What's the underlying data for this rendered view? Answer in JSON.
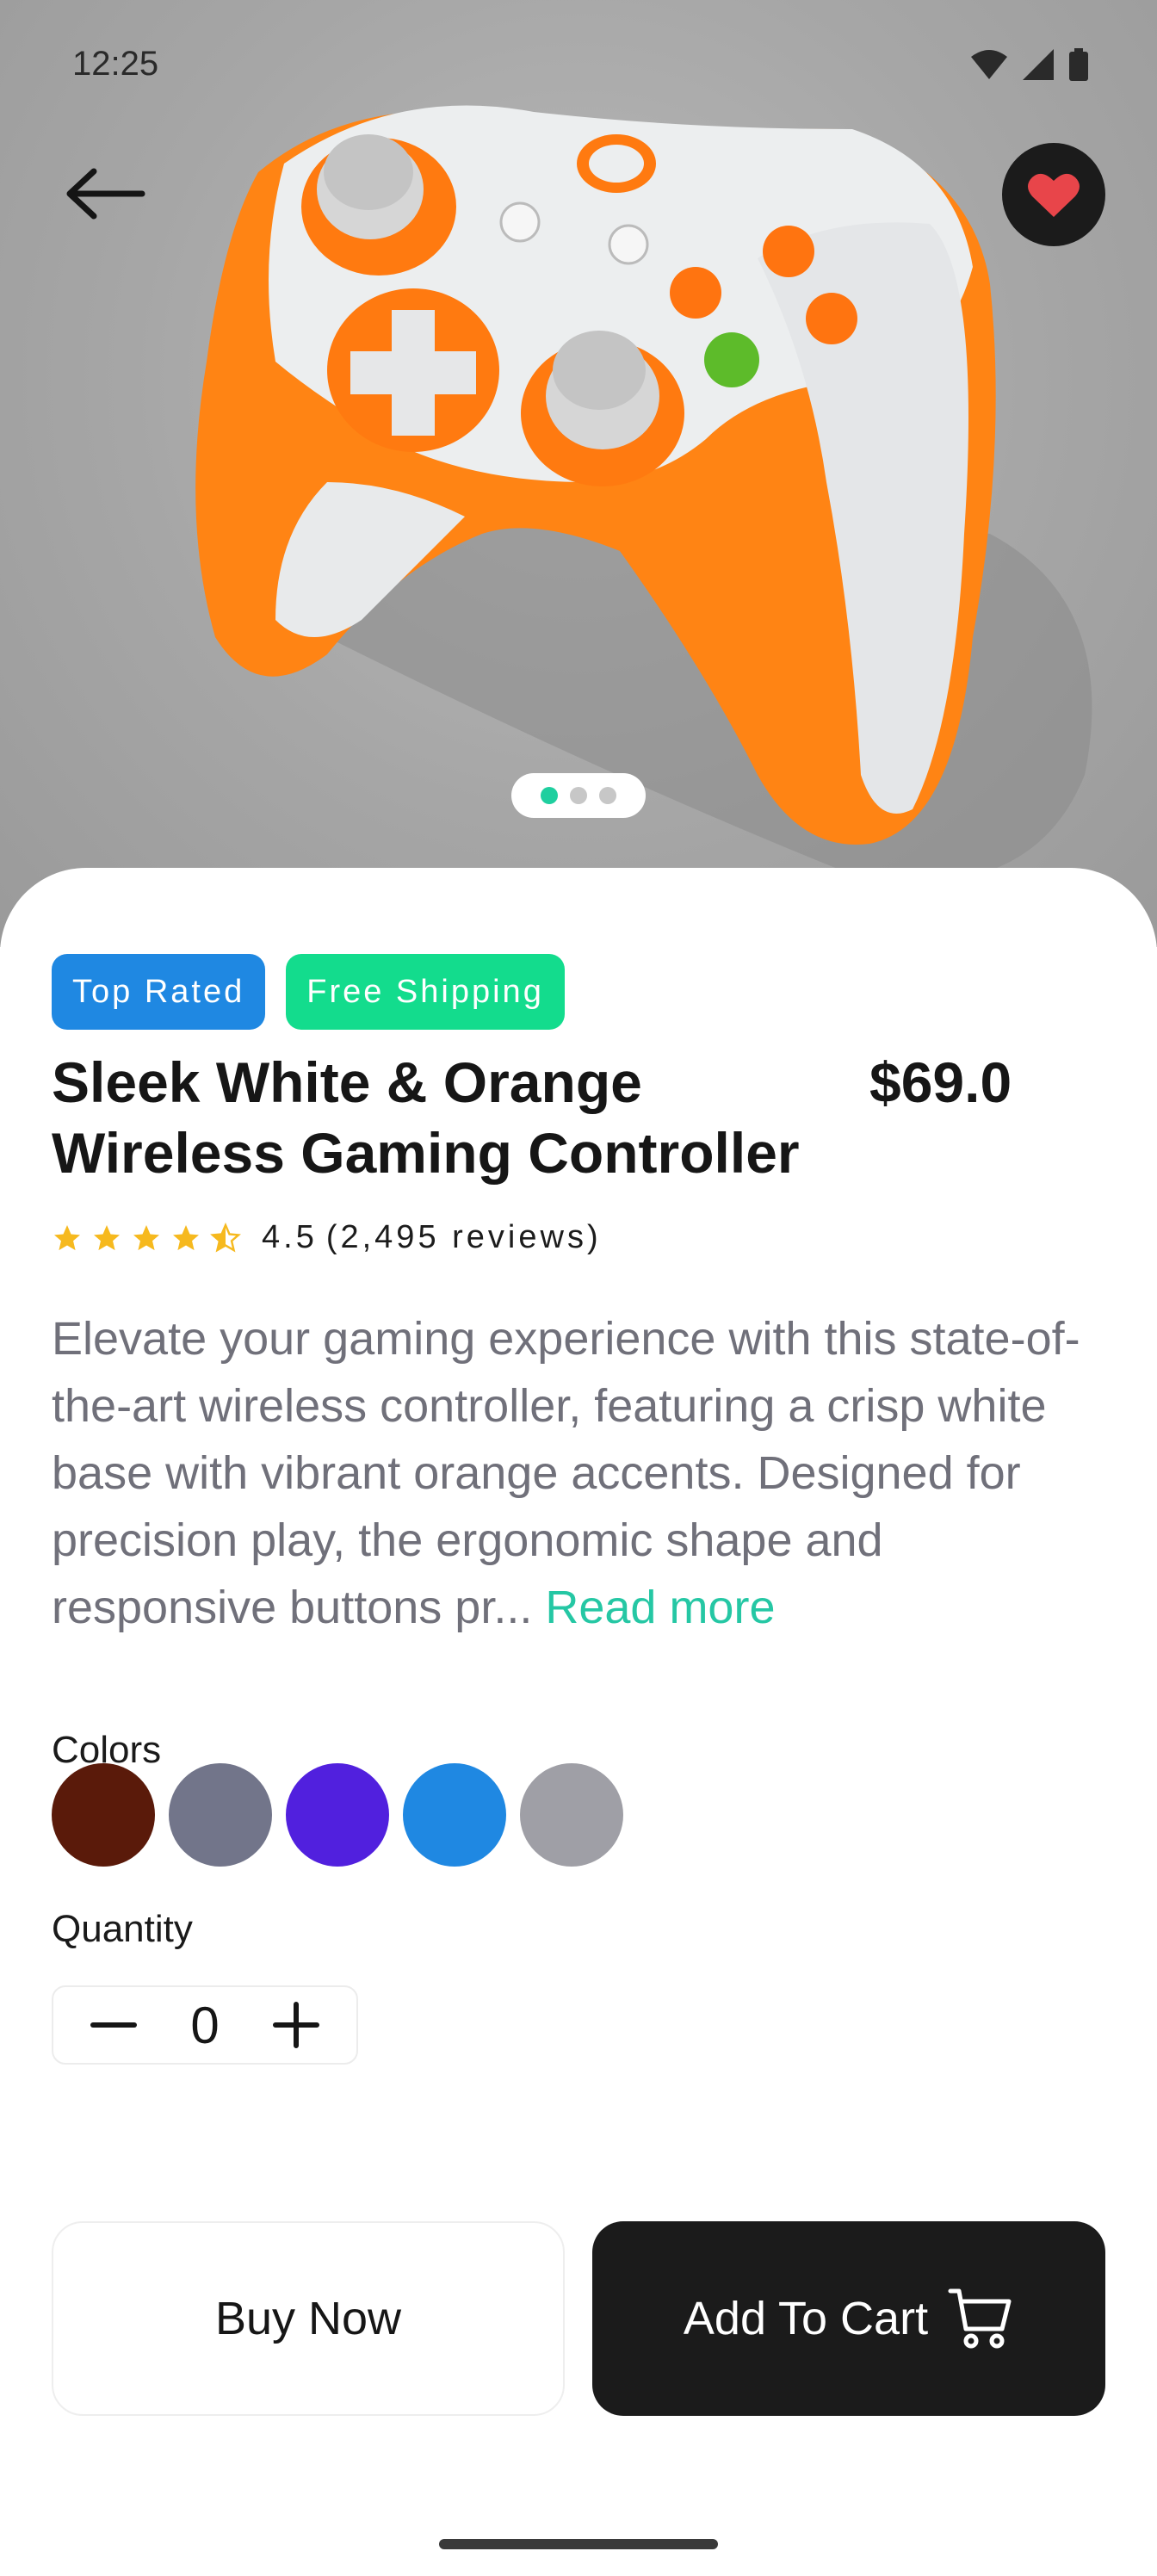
{
  "status": {
    "time": "12:25"
  },
  "product": {
    "badges": [
      "Top Rated",
      "Free Shipping"
    ],
    "title": "Sleek White & Orange Wireless Gaming Controller",
    "price": "$69.0",
    "rating": {
      "value": 4.5,
      "value_text": "4.5",
      "reviews_text": "(2,495 reviews)"
    },
    "description": "Elevate your gaming experience with this state-of-the-art wireless controller, featuring a crisp white base with vibrant orange accents. Designed for precision play, the ergonomic shape and responsive buttons pr...",
    "read_more": "Read more",
    "image_carousel": {
      "count": 3,
      "active": 1
    }
  },
  "colors": {
    "label": "Colors",
    "options": [
      "#5a1a0a",
      "#72758a",
      "#5120de",
      "#1f88e2",
      "#9f9fa6"
    ]
  },
  "quantity": {
    "label": "Quantity",
    "value": "0"
  },
  "actions": {
    "buy_now": "Buy Now",
    "add_to_cart": "Add To Cart"
  },
  "theme": {
    "accent": "#25c7a4",
    "dark": "#1b1b1b",
    "favorite": "#e8454a"
  }
}
